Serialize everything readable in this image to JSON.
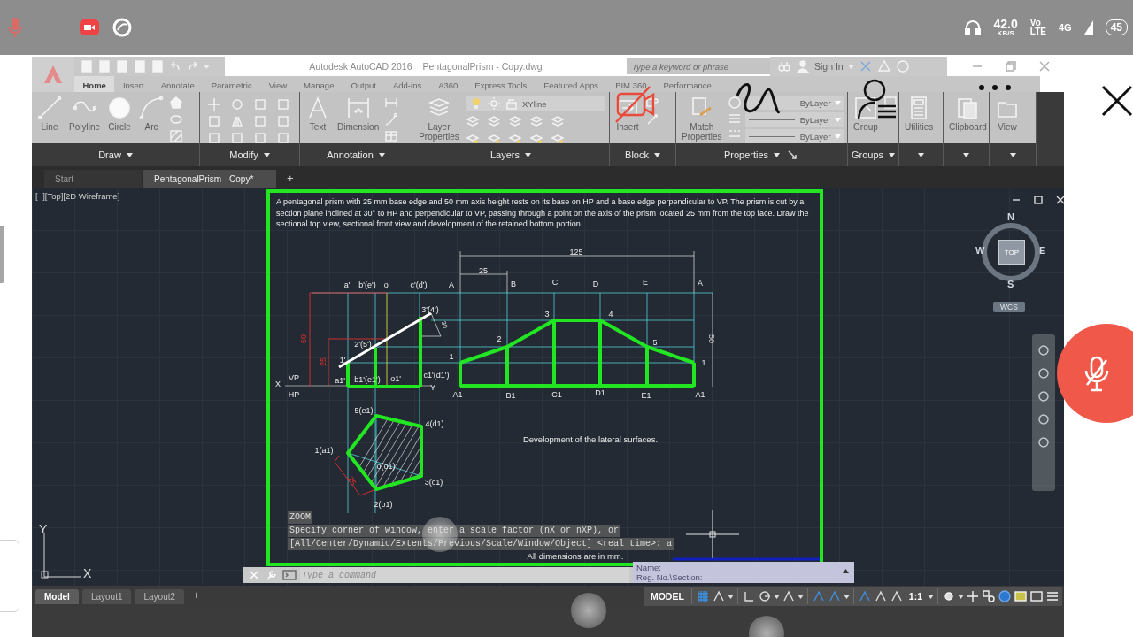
{
  "phone_status": {
    "rate": "42.0",
    "rate_unit": "KB/S",
    "volte_top": "Vo",
    "volte_bottom": "LTE",
    "network": "4G",
    "battery": "45"
  },
  "title_bar": {
    "app": "Autodesk AutoCAD 2016",
    "file": "PentagonalPrism - Copy.dwg",
    "search": {
      "placeholder": "Type a keyword or phrase"
    },
    "sign_in": "Sign In"
  },
  "ribbon_tabs": [
    {
      "label": "Home",
      "selected": true
    },
    {
      "label": "Insert",
      "selected": false
    },
    {
      "label": "Annotate",
      "selected": false
    },
    {
      "label": "Parametric",
      "selected": false
    },
    {
      "label": "View",
      "selected": false
    },
    {
      "label": "Manage",
      "selected": false
    },
    {
      "label": "Output",
      "selected": false
    },
    {
      "label": "Add-ins",
      "selected": false
    },
    {
      "label": "A360",
      "selected": false
    },
    {
      "label": "Express Tools",
      "selected": false
    },
    {
      "label": "Featured Apps",
      "selected": false
    },
    {
      "label": "BIM 360",
      "selected": false
    },
    {
      "label": "Performance",
      "selected": false
    }
  ],
  "ribbon_panels": [
    {
      "title": "Draw",
      "tools": [
        "Line",
        "Polyline",
        "Circle",
        "Arc"
      ]
    },
    {
      "title": "Modify"
    },
    {
      "title": "Annotation",
      "tools": [
        "Text",
        "Dimension"
      ]
    },
    {
      "title": "Layers",
      "tools": [
        "Layer Properties"
      ],
      "layer": "XYline"
    },
    {
      "title": "Block",
      "tools": [
        "Insert"
      ]
    },
    {
      "title": "Properties",
      "tools": [
        "Match Properties"
      ],
      "dropdowns": [
        "ByLayer",
        "ByLayer",
        "ByLayer"
      ]
    },
    {
      "title": "Groups",
      "tools": [
        "Group"
      ]
    },
    {
      "tools": [
        "Utilities"
      ]
    },
    {
      "tools": [
        "Clipboard"
      ]
    },
    {
      "tools": [
        "View"
      ]
    }
  ],
  "document_tabs": [
    {
      "label": "Start",
      "selected": false
    },
    {
      "label": "PentagonalPrism - Copy*",
      "selected": true
    }
  ],
  "new_tab": "+",
  "viewport_label": "[−][Top][2D Wireframe]",
  "sheet": {
    "problem": "A pentagonal prism with 25 mm base edge and 50 mm axis height rests on its base on HP and a base edge perpendicular to VP. The prism is cut by a section plane inclined at 30° to HP and perpendicular to VP, passing through a point on the axis of the prism located 25 mm from the top face. Draw the sectional top view, sectional front view and development of the retained bottom portion.",
    "labels": [
      "125",
      "25",
      "a'",
      "b'(e')",
      "o'",
      "c'(d')",
      "A",
      "B",
      "C",
      "D",
      "E",
      "A",
      "3'(4')",
      "3",
      "4",
      "30",
      "50",
      "2'(5')",
      "2",
      "5",
      "50",
      "25",
      "1'",
      "1",
      "1",
      "X",
      "VP",
      "a1'",
      "b1'(e1')",
      "o1'",
      "c1'(d1')",
      "HP",
      "Y",
      "A1",
      "B1",
      "C1",
      "D1",
      "E1",
      "A1",
      "5(e1)",
      "4(d1)",
      "1(a1)",
      "o(o1)",
      "25",
      "3(c1)",
      "2(b1)"
    ],
    "caption": "Development of the lateral surfaces.",
    "note": "All dimensions are in mm.",
    "title_block": [
      "Name:",
      "Reg. No.\\Section:"
    ]
  },
  "view_cube": {
    "n": "N",
    "s": "S",
    "e": "E",
    "w": "W",
    "face": "TOP",
    "ucs": "WCS"
  },
  "ucs_icon": {
    "x": "X",
    "y": "Y"
  },
  "command_history": [
    "ZOOM",
    "Specify corner of window, enter a scale factor (nX or nXP), or",
    "[All/Center/Dynamic/Extents/Previous/Scale/Window/Object] <real time>: a"
  ],
  "command_input": {
    "placeholder": "Type a command"
  },
  "layout_tabs": [
    {
      "label": "Model",
      "selected": true
    },
    {
      "label": "Layout1",
      "selected": false
    },
    {
      "label": "Layout2",
      "selected": false
    }
  ],
  "new_layout": "+",
  "status_bar": {
    "mode": "MODEL",
    "scale": "1:1"
  }
}
